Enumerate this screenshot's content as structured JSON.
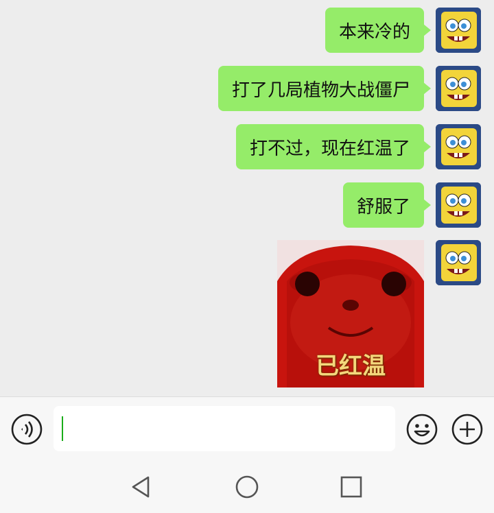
{
  "messages": [
    {
      "text": "本来冷的"
    },
    {
      "text": "打了几局植物大战僵尸"
    },
    {
      "text": "打不过，现在红温了"
    },
    {
      "text": "舒服了"
    }
  ],
  "sticker": {
    "caption": "已红温"
  },
  "input": {
    "value": ""
  },
  "icons": {
    "voice": "voice-icon",
    "emoji": "emoji-icon",
    "plus": "plus-icon",
    "back": "back-triangle-icon",
    "home": "home-circle-icon",
    "recents": "recents-square-icon"
  },
  "colors": {
    "bubble": "#95ec69",
    "background": "#ededed",
    "caret": "#1aad19"
  }
}
